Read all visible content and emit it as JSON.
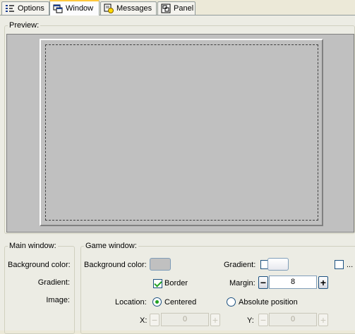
{
  "tabs": [
    {
      "label": "Options",
      "icon": "options-icon",
      "active": false
    },
    {
      "label": "Window",
      "icon": "window-icon",
      "active": true
    },
    {
      "label": "Messages",
      "icon": "messages-icon",
      "active": false
    },
    {
      "label": "Panel",
      "icon": "panel-icon",
      "active": false
    }
  ],
  "preview": {
    "legend": "Preview:"
  },
  "main_window": {
    "legend": "Main window:",
    "background_color_label": "Background color:",
    "gradient_label": "Gradient:",
    "image_label": "Image:"
  },
  "game_window": {
    "legend": "Game window:",
    "background_color_label": "Background color:",
    "background_color": "#c0c0c0",
    "gradient_label": "Gradient:",
    "extra_checkbox_label": "...",
    "border_label": "Border",
    "border_checked": true,
    "margin_label": "Margin:",
    "margin_value": "8",
    "location_label": "Location:",
    "location_centered_label": "Centered",
    "location_absolute_label": "Absolute position",
    "location_selected": "Centered",
    "x_label": "X:",
    "x_value": "0",
    "y_label": "Y:",
    "y_value": "0"
  },
  "colors": {
    "active_tab_accent": "#ffc83c",
    "preview_background": "#c0c0c0",
    "check_mark": "#21a121"
  }
}
